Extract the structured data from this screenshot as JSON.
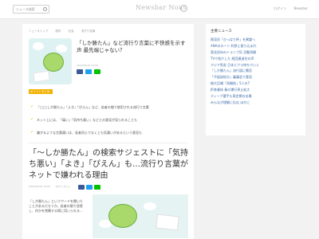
{
  "topbar": {
    "search_placeholder": "ニュース検索",
    "logo": "Newsbar Nous",
    "nav": [
      "ログイン",
      "Newsbar"
    ]
  },
  "breadcrumb": [
    "ニューストップ",
    "国内",
    "社会",
    "流行り言葉"
  ],
  "article": {
    "title": "「しか勝たん」など流行り言葉に不快感を示す声 最先端じゃない？",
    "date": "2022/02/19 15:00",
    "summary_label": "ポイントまとめ",
    "summary_items": [
      "「◯◯しか勝たん」「よき」「ぴえん」など、若者の間で使用される流行り言葉",
      "ネット上には、「痛い」「気持ち悪い」などとの意見が見られることも",
      "嫌がるような言葉遣いは、若者同士でなくとも気遣いがあるという意見も"
    ],
    "headline": "「～しか勝たん」の検索サジェストに「気持ち悪い」「よき」「ぴえん」も…流行り言葉がネットで嫌われる理由",
    "headline_date": "2022/02/19 15:00",
    "headline_source": "Jタウンネット",
    "body": "「しか勝たん」というワードを聞いたことがあるだろうか。若者の間で浸透し、何かを賞賛する際に用いられる…"
  },
  "share_colors": [
    "#3b5998",
    "#1da1f2",
    "#00c300"
  ],
  "sidebar": {
    "title": "主要ニュース",
    "items": [
      "尾見氏「ひっぱり杯」を異論へ",
      "ANAのローン 利息に振り込まれ",
      "東北初めのトランプ氏 活動再開",
      "TVで紹介した 経団連退任の声",
      "アジア男女 日本とクラ持ちでいく",
      "「しか勝たん」流行語に賛否",
      "「不起訴処分」審議会で意見",
      "総大臣補「再開前」5人の7",
      "JR各業体 春の運行停止拡大",
      "ディープ選手も再定期の出場",
      "みんなが理解に反応 ほかに"
    ]
  }
}
